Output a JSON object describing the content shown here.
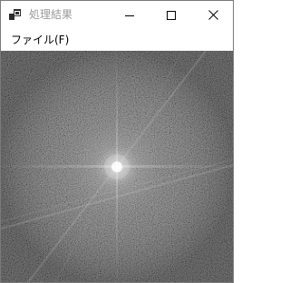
{
  "window": {
    "title": "処理結果",
    "icon": "app-window-icon"
  },
  "titlebar": {
    "buttons": [
      {
        "name": "minimize",
        "icon": "minimize-icon"
      },
      {
        "name": "maximize",
        "icon": "maximize-icon"
      },
      {
        "name": "close",
        "icon": "close-icon"
      }
    ]
  },
  "menu": {
    "items": [
      {
        "label": "ファイル(F)"
      }
    ]
  },
  "content": {
    "image": "fourier-spectrum-image",
    "colors": {
      "background": "#5c5c5c",
      "center": "#ffffff"
    }
  }
}
